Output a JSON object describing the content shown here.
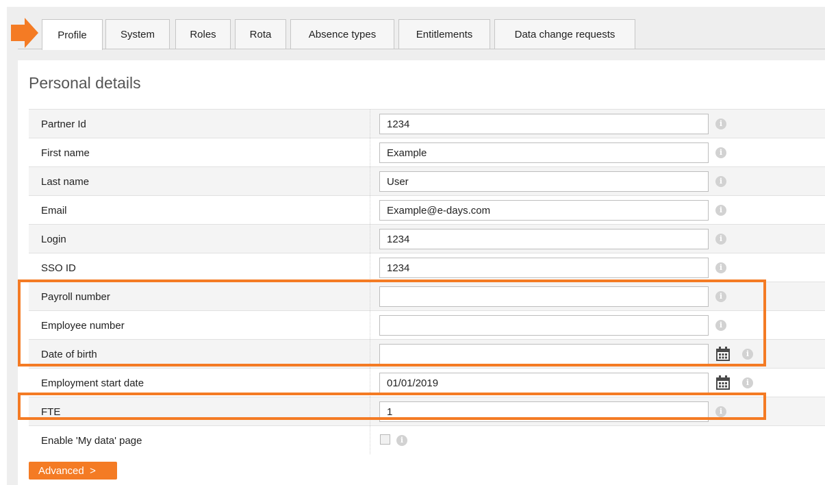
{
  "tabs": [
    {
      "label": "Profile",
      "active": true
    },
    {
      "label": "System"
    },
    {
      "label": "Roles"
    },
    {
      "label": "Rota"
    },
    {
      "label": "Absence types"
    },
    {
      "label": "Entitlements"
    },
    {
      "label": "Data change requests"
    }
  ],
  "section": {
    "title": "Personal details"
  },
  "fields": [
    {
      "label": "Partner Id",
      "value": "1234"
    },
    {
      "label": "First name",
      "value": "Example"
    },
    {
      "label": "Last name",
      "value": "User"
    },
    {
      "label": "Email",
      "value": "Example@e-days.com"
    },
    {
      "label": "Login",
      "value": "1234"
    },
    {
      "label": "SSO ID",
      "value": "1234"
    },
    {
      "label": "Payroll number",
      "value": ""
    },
    {
      "label": "Employee number",
      "value": ""
    },
    {
      "label": "Date of birth",
      "value": "",
      "has_calendar": true
    },
    {
      "label": "Employment start date",
      "value": "01/01/2019",
      "has_calendar": true
    },
    {
      "label": "FTE",
      "value": "1"
    },
    {
      "label": "Enable 'My data' page",
      "type": "checkbox",
      "checked": false
    }
  ],
  "advanced_button": {
    "label": "Advanced",
    "chevron": ">"
  },
  "colors": {
    "accent": "#f47b24",
    "row_alt": "#f4f4f4",
    "info_icon": "#d2d2d2"
  },
  "icons": {
    "info": "info-icon",
    "calendar": "calendar-icon",
    "pointer": "arrow-right-icon"
  }
}
